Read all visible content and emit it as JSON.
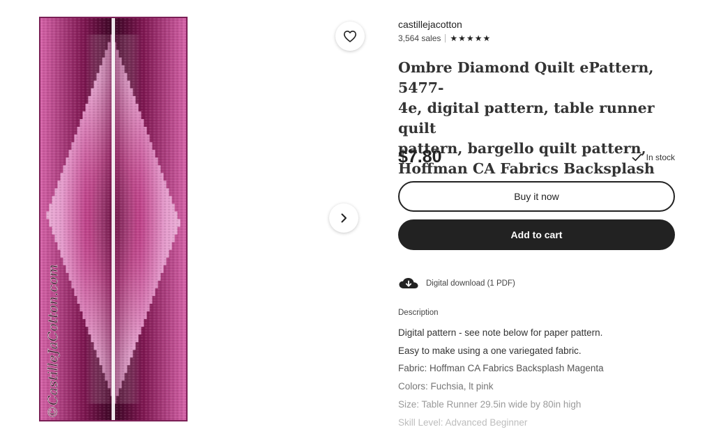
{
  "listing": {
    "image": {
      "alt_icon": "quilt-image",
      "colors": {
        "dark": "#4a0b30",
        "mid": "#b8337e",
        "light": "#f3c8e6",
        "border": "#7a1f55"
      },
      "watermark": "©CastilleJaCotton.com"
    },
    "favorite_icon": "heart-icon",
    "next_icon": "chevron-right-icon",
    "shop": {
      "name": "castillejacotton",
      "sales": "3,564 sales",
      "rating_stars": 5
    },
    "title_lines": [
      "Ombre Diamond Quilt ePattern, 5477-",
      "4e, digital pattern, table runner quilt",
      "pattern, bargello quilt pattern,",
      "Hoffman CA Fabrics Backsplash"
    ],
    "price": "$7.80",
    "stock": {
      "icon": "checkmark-icon",
      "label": "In stock"
    },
    "buttons": {
      "buy_now": "Buy it now",
      "add_to_cart": "Add to cart"
    },
    "download": {
      "icon": "cloud-download-icon",
      "label": "Digital download (1 PDF)"
    },
    "description": {
      "heading": "Description",
      "lines": [
        "Digital pattern - see note below for paper pattern.",
        "Easy to make using a one variegated fabric.",
        "Fabric: Hoffman CA Fabrics Backsplash Magenta",
        "Colors: Fuchsia, lt pink",
        "Size: Table Runner 29.5in wide by 80in high",
        "Skill Level: Advanced Beginner"
      ]
    }
  }
}
